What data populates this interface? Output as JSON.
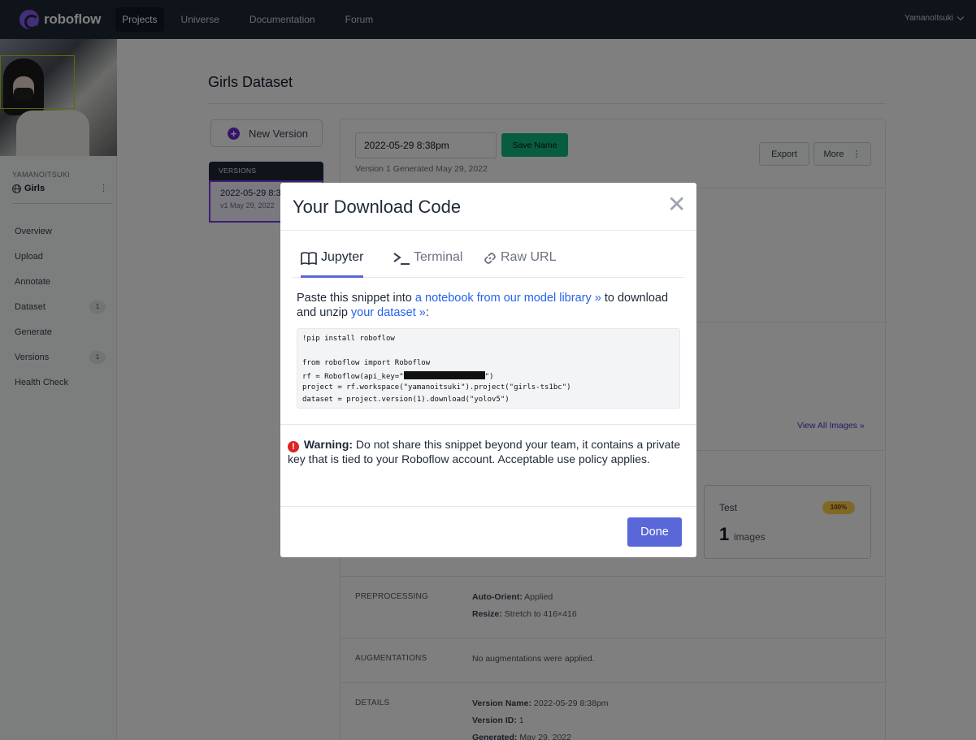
{
  "nav": {
    "brand": "roboflow",
    "items": [
      "Projects",
      "Universe",
      "Documentation",
      "Forum"
    ],
    "user": "YamanoItsuki"
  },
  "sidebar": {
    "workspace": "YAMANOITSUKI",
    "project": "Girls",
    "items": [
      {
        "label": "Overview",
        "count": null
      },
      {
        "label": "Upload",
        "count": null
      },
      {
        "label": "Annotate",
        "count": null
      },
      {
        "label": "Dataset",
        "count": "1"
      },
      {
        "label": "Generate",
        "count": null
      },
      {
        "label": "Versions",
        "count": "1"
      },
      {
        "label": "Health Check",
        "count": null
      }
    ]
  },
  "main": {
    "title": "Girls Dataset",
    "new_version": "New Version",
    "versions_header": "VERSIONS",
    "version_card": {
      "title": "2022-05-29 8:38pm",
      "sub": "v1 May 29, 2022"
    },
    "version_name_value": "2022-05-29 8:38pm",
    "save_name": "Save Name",
    "generated": "Version 1 Generated May 29, 2022",
    "export": "Export",
    "more": "More",
    "view_all": "View All Images",
    "test": {
      "label": "Test",
      "badge": "100%",
      "count": "1",
      "unit": "images"
    },
    "preprocessing": {
      "label": "PREPROCESSING",
      "auto_orient_key": "Auto-Orient:",
      "auto_orient_val": "Applied",
      "resize_key": "Resize:",
      "resize_val": "Stretch to 416×416"
    },
    "augmentations": {
      "label": "AUGMENTATIONS",
      "value": "No augmentations were applied."
    },
    "details": {
      "label": "DETAILS",
      "name_key": "Version Name:",
      "name_val": "2022-05-29 8:38pm",
      "id_key": "Version ID:",
      "id_val": "1",
      "gen_key": "Generated:",
      "gen_val": "May 29, 2022"
    }
  },
  "modal": {
    "title": "Your Download Code",
    "tabs": [
      "Jupyter",
      "Terminal",
      "Raw URL"
    ],
    "instr_pre": "Paste this snippet into ",
    "instr_link1": "a notebook from our model library",
    "instr_mid": " to download and unzip ",
    "instr_link2": "your dataset",
    "instr_post": ":",
    "code": {
      "line1": "!pip install roboflow",
      "line2": "from roboflow import Roboflow",
      "line3_pre": "rf = Roboflow(api_key=\"",
      "line3_post": "\")",
      "line4": "project = rf.workspace(\"yamanoitsuki\").project(\"girls-ts1bc\")",
      "line5": "dataset = project.version(1).download(\"yolov5\")"
    },
    "warning_bold": "Warning:",
    "warning_text": " Do not share this snippet beyond your team, it contains a private key that is tied to your Roboflow account. Acceptable use policy applies.",
    "done": "Done"
  }
}
